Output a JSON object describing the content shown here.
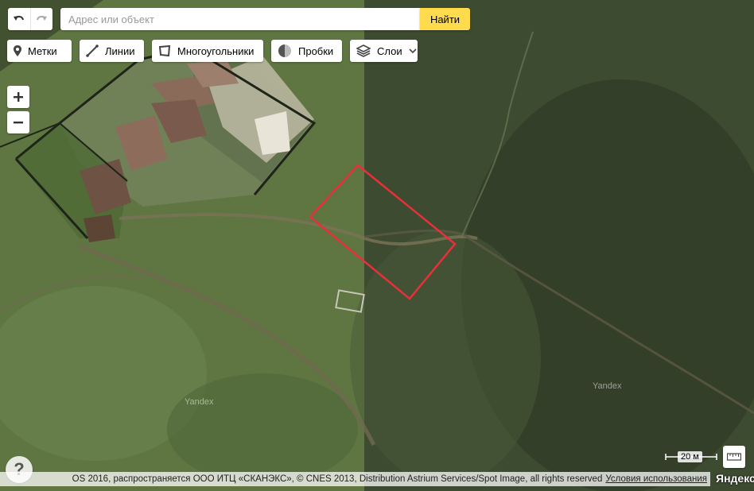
{
  "toolbar": {
    "undo_icon": "undo-icon",
    "redo_icon": "redo-icon",
    "search_placeholder": "Адрес или объект",
    "find_label": "Найти",
    "tools": {
      "placemarks": "Метки",
      "lines": "Линии",
      "polygons": "Многоугольники",
      "traffic": "Пробки",
      "layers": "Слои"
    }
  },
  "zoom": {
    "in": "+",
    "out": "−"
  },
  "help": "?",
  "map": {
    "watermark": "Yandex",
    "selection_color": "#e8303a"
  },
  "scale": {
    "label": "20 м"
  },
  "footer": {
    "copyright": "OS 2016, распространяется ООО ИТЦ «СКАНЭКС», © CNES 2013, Distribution Astrium Services/Spot Image, all rights reserved",
    "terms": "Условия использования",
    "logo": "Яндекс"
  },
  "colors": {
    "accent": "#ffdb4d"
  }
}
